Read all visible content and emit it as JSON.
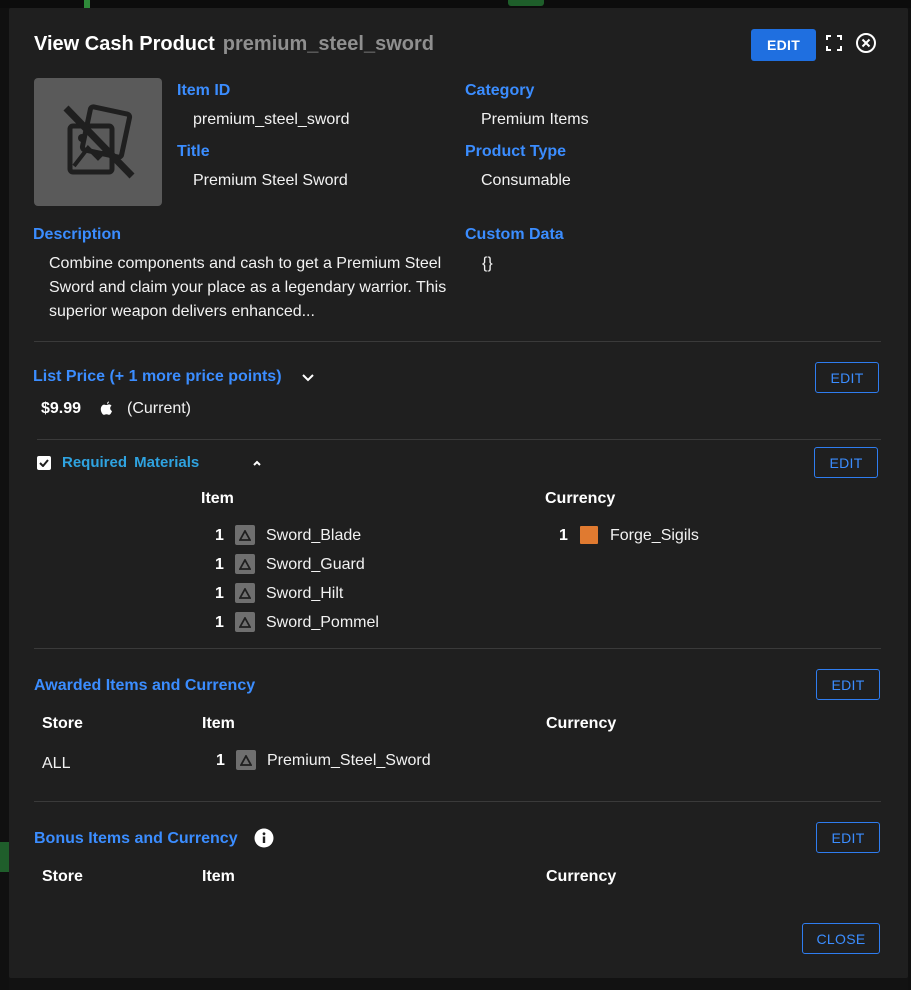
{
  "modal": {
    "title": "View Cash Product",
    "item_slug": "premium_steel_sword",
    "edit_label": "EDIT",
    "close_label": "CLOSE"
  },
  "details": {
    "item_id_label": "Item ID",
    "item_id": "premium_steel_sword",
    "title_label": "Title",
    "title": "Premium Steel Sword",
    "category_label": "Category",
    "category": "Premium Items",
    "product_type_label": "Product Type",
    "product_type": "Consumable",
    "description_label": "Description",
    "description": "Combine components and cash to get a Premium Steel Sword and claim your place as a legendary warrior. This superior weapon delivers enhanced...",
    "custom_data_label": "Custom Data",
    "custom_data": "{}"
  },
  "list_price": {
    "label": "List Price (+ 1 more price points)",
    "amount": "$9.99",
    "status": "(Current)",
    "edit_label": "EDIT"
  },
  "required_materials": {
    "label": "Required Materials",
    "edit_label": "EDIT",
    "item_header": "Item",
    "currency_header": "Currency",
    "items": [
      {
        "qty": "1",
        "name": "Sword_Blade"
      },
      {
        "qty": "1",
        "name": "Sword_Guard"
      },
      {
        "qty": "1",
        "name": "Sword_Hilt"
      },
      {
        "qty": "1",
        "name": "Sword_Pommel"
      }
    ],
    "currencies": [
      {
        "qty": "1",
        "name": "Forge_Sigils",
        "color": "#e07a30"
      }
    ]
  },
  "awarded": {
    "label": "Awarded Items and Currency",
    "edit_label": "EDIT",
    "store_header": "Store",
    "item_header": "Item",
    "currency_header": "Currency",
    "rows": [
      {
        "store": "ALL",
        "qty": "1",
        "item": "Premium_Steel_Sword"
      }
    ]
  },
  "bonus": {
    "label": "Bonus Items and Currency",
    "edit_label": "EDIT",
    "store_header": "Store",
    "item_header": "Item",
    "currency_header": "Currency"
  },
  "colors": {
    "accent_blue": "#3b8dff",
    "primary_button": "#1f6fe0",
    "panel_bg": "#1f1f1f",
    "required_label": "#2fa3e0"
  }
}
